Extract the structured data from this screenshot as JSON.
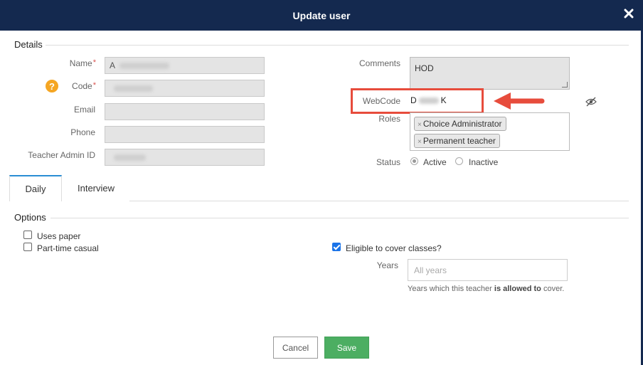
{
  "dialog": {
    "title": "Update user"
  },
  "details": {
    "section_title": "Details",
    "name_label": "Name",
    "name_value": "A",
    "code_label": "Code",
    "email_label": "Email",
    "phone_label": "Phone",
    "teacher_admin_id_label": "Teacher Admin ID",
    "required_marker": "*",
    "help_glyph": "?",
    "comments_label": "Comments",
    "comments_value": "HOD",
    "webcode_label": "WebCode",
    "webcode_prefix": "D",
    "webcode_suffix": "K",
    "roles_label": "Roles",
    "roles": [
      "Choice Administrator",
      "Permanent teacher"
    ],
    "remove_glyph": "×",
    "status_label": "Status",
    "status_options": [
      "Active",
      "Inactive"
    ],
    "status_selected": "Active"
  },
  "tabs": [
    "Daily",
    "Interview"
  ],
  "active_tab": "Daily",
  "options": {
    "section_title": "Options",
    "uses_paper": "Uses paper",
    "part_time_casual": "Part-time casual",
    "eligible_cover": "Eligible to cover classes?",
    "eligible_cover_checked": true,
    "years_label": "Years",
    "years_placeholder": "All years",
    "hint_prefix": "Years which this teacher ",
    "hint_bold": "is allowed to",
    "hint_suffix": " cover."
  },
  "buttons": {
    "cancel": "Cancel",
    "save": "Save"
  },
  "colors": {
    "header_bg": "#14294f",
    "save_green": "#4cae62",
    "highlight_red": "#e74c3c",
    "help_orange": "#f5a623",
    "tab_accent": "#2a8dd4"
  }
}
